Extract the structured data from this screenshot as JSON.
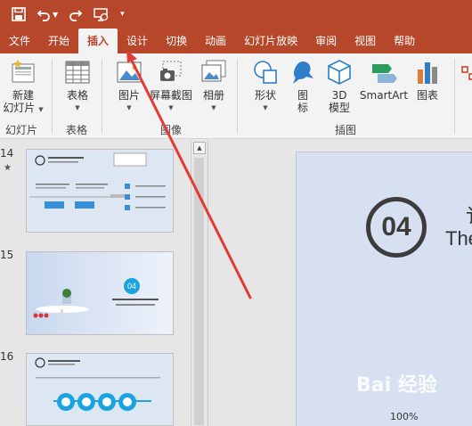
{
  "quick_access": {
    "save_icon": "save-icon",
    "undo_icon": "undo-icon",
    "redo_icon": "redo-icon",
    "start_from_beginning_icon": "slideshow-start-icon",
    "customize_icon": "customize-qat-icon"
  },
  "tabs": [
    "文件",
    "开始",
    "插入",
    "设计",
    "切换",
    "动画",
    "幻灯片放映",
    "审阅",
    "视图",
    "帮助"
  ],
  "active_tab": "插入",
  "ribbon": {
    "new_slide_label_1": "新建",
    "new_slide_label_2": "幻灯片",
    "slides_group": "幻灯片",
    "table_label": "表格",
    "tables_group": "表格",
    "picture_label": "图片",
    "screenshot_label": "屏幕截图",
    "album_label": "相册",
    "images_group": "图像",
    "shapes_label": "形状",
    "icons_label_1": "图",
    "icons_label_2": "标",
    "model3d_label_1": "3D",
    "model3d_label_2": "模型",
    "smartart_label": "SmartArt",
    "chart_label": "图表",
    "illustrations_group": "插图"
  },
  "thumbnails": [
    {
      "number": "14",
      "marker": "★"
    },
    {
      "number": "15",
      "badge": "04"
    },
    {
      "number": "16"
    }
  ],
  "main_slide": {
    "number_badge": "04",
    "title_cn_partial": "讠",
    "title_en_partial": "The"
  },
  "status": {
    "zoom": "100%"
  },
  "watermark": "Bai 经验",
  "colors": {
    "brand": "#b7472a",
    "ribbon_bg": "#f3f3f3",
    "annotation_arrow": "#e53935"
  }
}
